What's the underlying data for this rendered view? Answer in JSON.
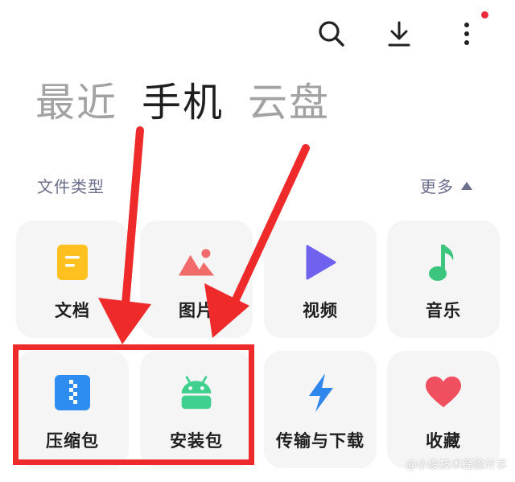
{
  "header": {
    "search_icon": "search-icon",
    "download_icon": "download-icon",
    "more_icon": "more-vertical-icon",
    "notification_dot_color": "#ee2a3a"
  },
  "tabs": [
    {
      "label": "最近",
      "active": false
    },
    {
      "label": "手机",
      "active": true
    },
    {
      "label": "云盘",
      "active": false
    }
  ],
  "section": {
    "title": "文件类型",
    "more_label": "更多"
  },
  "categories": [
    {
      "label": "文档",
      "icon": "document-icon",
      "color": "#ffc020"
    },
    {
      "label": "图片",
      "icon": "image-icon",
      "color": "#f26b6b"
    },
    {
      "label": "视频",
      "icon": "play-icon",
      "color": "#6f62ef"
    },
    {
      "label": "音乐",
      "icon": "music-note-icon",
      "color": "#3cc57e"
    },
    {
      "label": "压缩包",
      "icon": "archive-icon",
      "color": "#2d8df0"
    },
    {
      "label": "安装包",
      "icon": "android-icon",
      "color": "#3fcf8e"
    },
    {
      "label": "传输与下载",
      "icon": "lightning-icon",
      "color": "#2f86ec"
    },
    {
      "label": "收藏",
      "icon": "heart-icon",
      "color": "#f04f60"
    }
  ],
  "annotation": {
    "color": "#ee2a2a"
  },
  "watermark": "@小俊技术经验分享"
}
